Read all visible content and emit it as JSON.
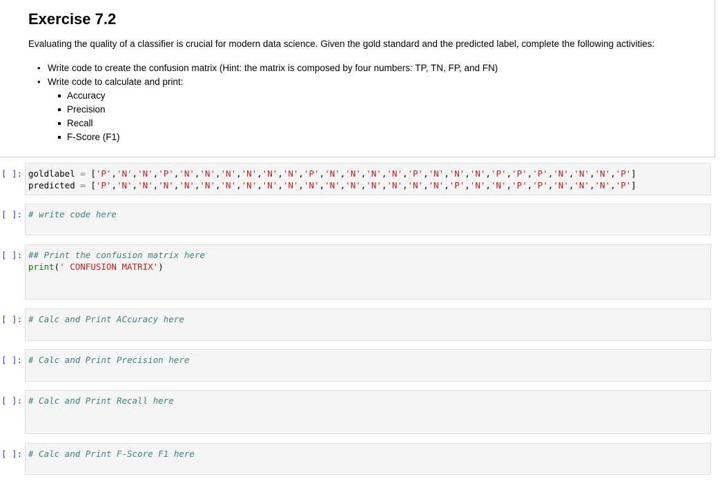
{
  "markdown": {
    "title": "Exercise 7.2",
    "intro": "Evaluating the quality of a classifier is crucial for modern data science. Given the gold standard and the predicted label, complete the following activities:",
    "bullets": [
      "Write code to create the confusion matrix (Hint: the matrix is composed by four numbers: TP, TN, FP, and FN)",
      "Write code to calculate and print:"
    ],
    "sub_bullets": [
      "Accuracy",
      "Precision",
      "Recall",
      "F-Score (F1)"
    ]
  },
  "prompt_label": "[ ]:",
  "cells": {
    "data": {
      "gold_name": "goldlabel",
      "gold_values": [
        "P",
        "N",
        "N",
        "P",
        "N",
        "N",
        "N",
        "N",
        "N",
        "N",
        "P",
        "N",
        "N",
        "N",
        "N",
        "P",
        "N",
        "N",
        "N",
        "P",
        "P",
        "P",
        "N",
        "N",
        "N",
        "P"
      ],
      "pred_name": "predicted",
      "pred_values": [
        "P",
        "N",
        "N",
        "N",
        "N",
        "N",
        "N",
        "N",
        "N",
        "N",
        "N",
        "N",
        "N",
        "N",
        "N",
        "N",
        "N",
        "P",
        "N",
        "N",
        "P",
        "P",
        "N",
        "N",
        "N",
        "P"
      ],
      "assign_op": "=",
      "gold_line_text": "['P','N','N','P','N','N','N','N','N','N','P','N','N','N','N','P','N','N','N','P','P','P','N','N','N','P']",
      "pred_line_text": "['P','N','N','N','N','N','N','N','N','N','N','N','N','N','N','N','N','P','N','N','P','P','N','N','N','P']"
    },
    "write_code": "# write code here",
    "confusion": {
      "comment": "## Print the confusion matrix here",
      "func": "print",
      "open": "(",
      "arg": "' CONFUSION MATRIX'",
      "close": ")"
    },
    "accuracy": "# Calc and Print ACcuracy here",
    "precision": "# Calc and Print Precision here",
    "recall": "# Calc and Print Recall here",
    "fscore": "# Calc and Print F-Score F1 here"
  }
}
